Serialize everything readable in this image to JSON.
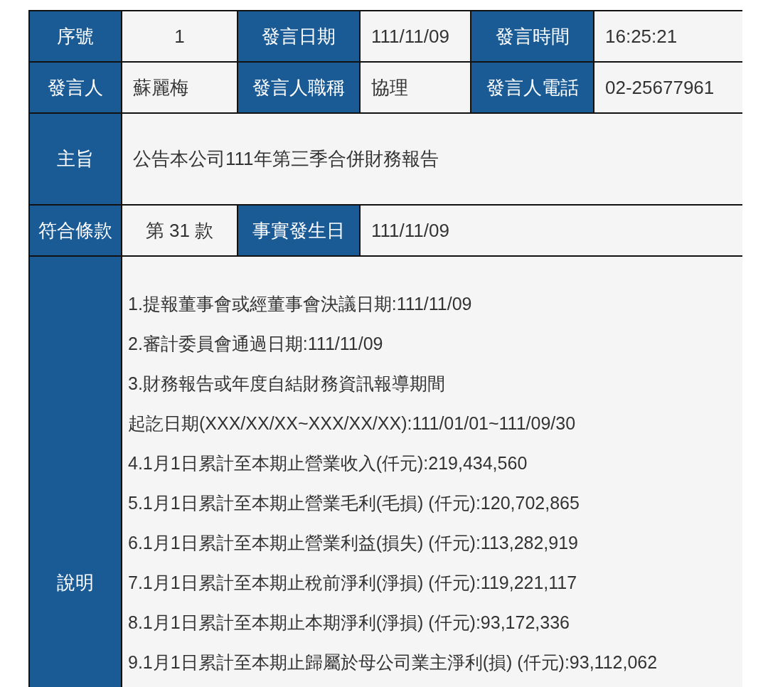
{
  "rows": [
    [
      {
        "kind": "label",
        "text": "序號"
      },
      {
        "kind": "ordinal",
        "text": "1"
      },
      {
        "kind": "label",
        "text": "發言日期"
      },
      {
        "kind": "value",
        "text": "111/11/09"
      },
      {
        "kind": "label",
        "text": "發言時間"
      },
      {
        "kind": "value",
        "text": "16:25:21"
      }
    ],
    [
      {
        "kind": "label",
        "text": "發言人"
      },
      {
        "kind": "value",
        "text": "蘇麗梅"
      },
      {
        "kind": "label",
        "text": "發言人職稱"
      },
      {
        "kind": "value",
        "text": "協理"
      },
      {
        "kind": "label",
        "text": "發言人電話"
      },
      {
        "kind": "value",
        "text": "02-25677961"
      }
    ],
    [
      {
        "kind": "label",
        "text": "主旨"
      },
      {
        "kind": "value",
        "text": "公告本公司111年第三季合併財務報告"
      }
    ],
    [
      {
        "kind": "label",
        "text": "符合條款"
      },
      {
        "kind": "ordinal",
        "text": "第 31 款"
      },
      {
        "kind": "label",
        "text": "事實發生日"
      },
      {
        "kind": "value",
        "text": "111/11/09"
      }
    ]
  ],
  "description": {
    "label": "說明",
    "lines": [
      "1.提報董事會或經董事會決議日期:111/11/09",
      "2.審計委員會通過日期:111/11/09",
      "3.財務報告或年度自結財務資訊報導期間",
      "起訖日期(XXX/XX/XX~XXX/XX/XX):111/01/01~111/09/30",
      "4.1月1日累計至本期止營業收入(仟元):219,434,560",
      "5.1月1日累計至本期止營業毛利(毛損) (仟元):120,702,865",
      "6.1月1日累計至本期止營業利益(損失) (仟元):113,282,919",
      "7.1月1日累計至本期止稅前淨利(淨損) (仟元):119,221,117",
      "8.1月1日累計至本期止本期淨利(淨損) (仟元):93,172,336",
      "9.1月1日累計至本期止歸屬於母公司業主淨利(損) (仟元):93,112,062"
    ]
  }
}
